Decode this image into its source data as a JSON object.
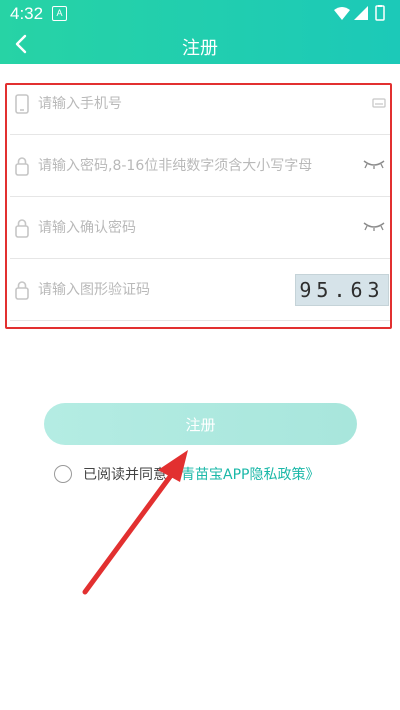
{
  "status_bar": {
    "time": "4:32",
    "notification_letter": "A"
  },
  "header": {
    "title": "注册"
  },
  "form": {
    "phone_placeholder": "请输入手机号",
    "password_placeholder": "请输入密码,8-16位非纯数字须含大小写字母",
    "confirm_placeholder": "请输入确认密码",
    "captcha_placeholder": "请输入图形验证码",
    "captcha_text": "95.63"
  },
  "submit_label": "注册",
  "agreement": {
    "prefix": "已阅读并同意",
    "policy_link": "《青苗宝APP隐私政策》"
  },
  "colors": {
    "accent": "#1cc9b8",
    "header_gradient_start": "#27d3a5",
    "button_bg": "#b4ece3",
    "link": "#1bb8a8",
    "annotation": "#e23030"
  }
}
